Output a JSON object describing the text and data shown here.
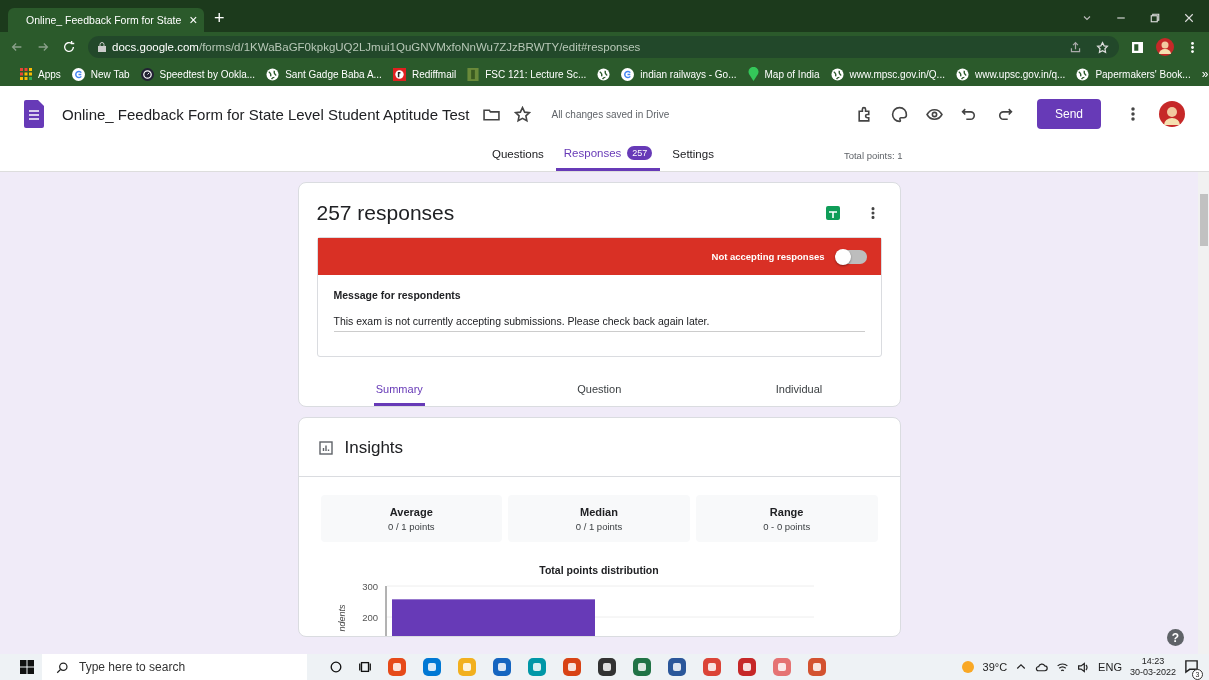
{
  "browser": {
    "tab": {
      "title": "Online_ Feedback Form for State",
      "close": "×"
    },
    "new_tab": "+",
    "url": {
      "host": "docs.google.com",
      "path": "/forms/d/1KWaBaGF0kpkgUQ2LJmui1QuGNVMxfoNnWu7ZJzBRWTY/edit#responses"
    },
    "bookmarks": [
      {
        "kind": "apps",
        "label": "Apps"
      },
      {
        "kind": "google",
        "label": "New Tab"
      },
      {
        "kind": "speedtest",
        "label": "Speedtest by Ookla..."
      },
      {
        "kind": "globe",
        "label": "Sant Gadge Baba A..."
      },
      {
        "kind": "rediff",
        "label": "Rediffmail"
      },
      {
        "kind": "book",
        "label": "FSC 121: Lecture Sc..."
      },
      {
        "kind": "globe"
      },
      {
        "kind": "google",
        "label": "indian railways - Go..."
      },
      {
        "kind": "pin",
        "label": "Map of India"
      },
      {
        "kind": "globe",
        "label": "www.mpsc.gov.in/Q..."
      },
      {
        "kind": "globe",
        "label": "www.upsc.gov.in/q..."
      },
      {
        "kind": "globe",
        "label": "Papermakers' Book..."
      }
    ],
    "more": "»"
  },
  "form": {
    "title": "Online_ Feedback Form for State Level Student Aptitude Test",
    "save_status": "All changes saved in Drive",
    "send": "Send",
    "tabs": [
      {
        "label": "Questions",
        "selected": false
      },
      {
        "label": "Responses",
        "badge": "257",
        "selected": true
      },
      {
        "label": "Settings",
        "selected": false
      }
    ],
    "total_points": "Total points: 1"
  },
  "responses": {
    "count": "257 responses",
    "banner": {
      "label": "Not accepting responses",
      "on": false
    },
    "message_label": "Message for respondents",
    "message": "This exam is not currently accepting submissions. Please check back again later.",
    "views": [
      {
        "label": "Summary",
        "selected": true
      },
      {
        "label": "Question",
        "selected": false
      },
      {
        "label": "Individual",
        "selected": false
      }
    ]
  },
  "insights": {
    "title": "Insights",
    "stats": [
      {
        "label": "Average",
        "value": "0 / 1 points"
      },
      {
        "label": "Median",
        "value": "0 / 1 points"
      },
      {
        "label": "Range",
        "value": "0 - 0 points"
      }
    ],
    "chart_data": {
      "type": "bar",
      "title": "Total points distribution",
      "ylabel": "ndents",
      "values": [
        257
      ],
      "ylim": [
        0,
        300
      ],
      "yticks": [
        200,
        300
      ]
    }
  },
  "help": "?",
  "taskbar": {
    "search_placeholder": "Type here to search",
    "weather": "39°C",
    "language": "ENG",
    "time": "14:23",
    "date": "30-03-2022",
    "notifications": "3"
  }
}
